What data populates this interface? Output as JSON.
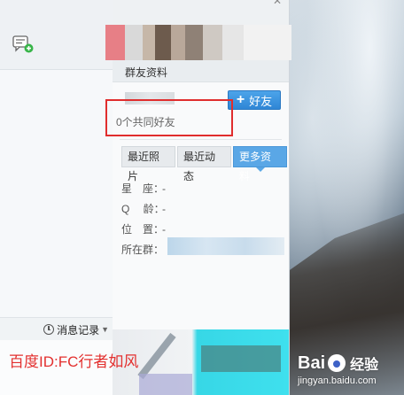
{
  "panel": {
    "title": "群友资料",
    "add_friend_label": "好友",
    "mutual_friends": "0个共同好友",
    "tabs": [
      {
        "label": "最近照片",
        "active": false
      },
      {
        "label": "最近动态",
        "active": false
      },
      {
        "label": "更多资料",
        "active": true
      }
    ],
    "info": [
      {
        "label": "星　座：",
        "value": "-"
      },
      {
        "label": "Q　 龄：",
        "value": "-"
      },
      {
        "label": "位　置：",
        "value": "-"
      },
      {
        "label": "所在群：",
        "value": ""
      }
    ]
  },
  "chat": {
    "history_label": "消息记录"
  },
  "overlay": {
    "author_watermark": "百度ID:FC行者如风",
    "logo_text_left": "Bai",
    "logo_text_right": "经验",
    "logo_url": "jingyan.baidu.com"
  },
  "colors": {
    "accent_blue": "#2f86d6",
    "highlight_red": "#e02d2d",
    "watermark_red": "#e3302f"
  },
  "icons": [
    "chat-add-icon",
    "clock-icon",
    "plus-icon",
    "baidu-paw-icon",
    "close-icon"
  ]
}
